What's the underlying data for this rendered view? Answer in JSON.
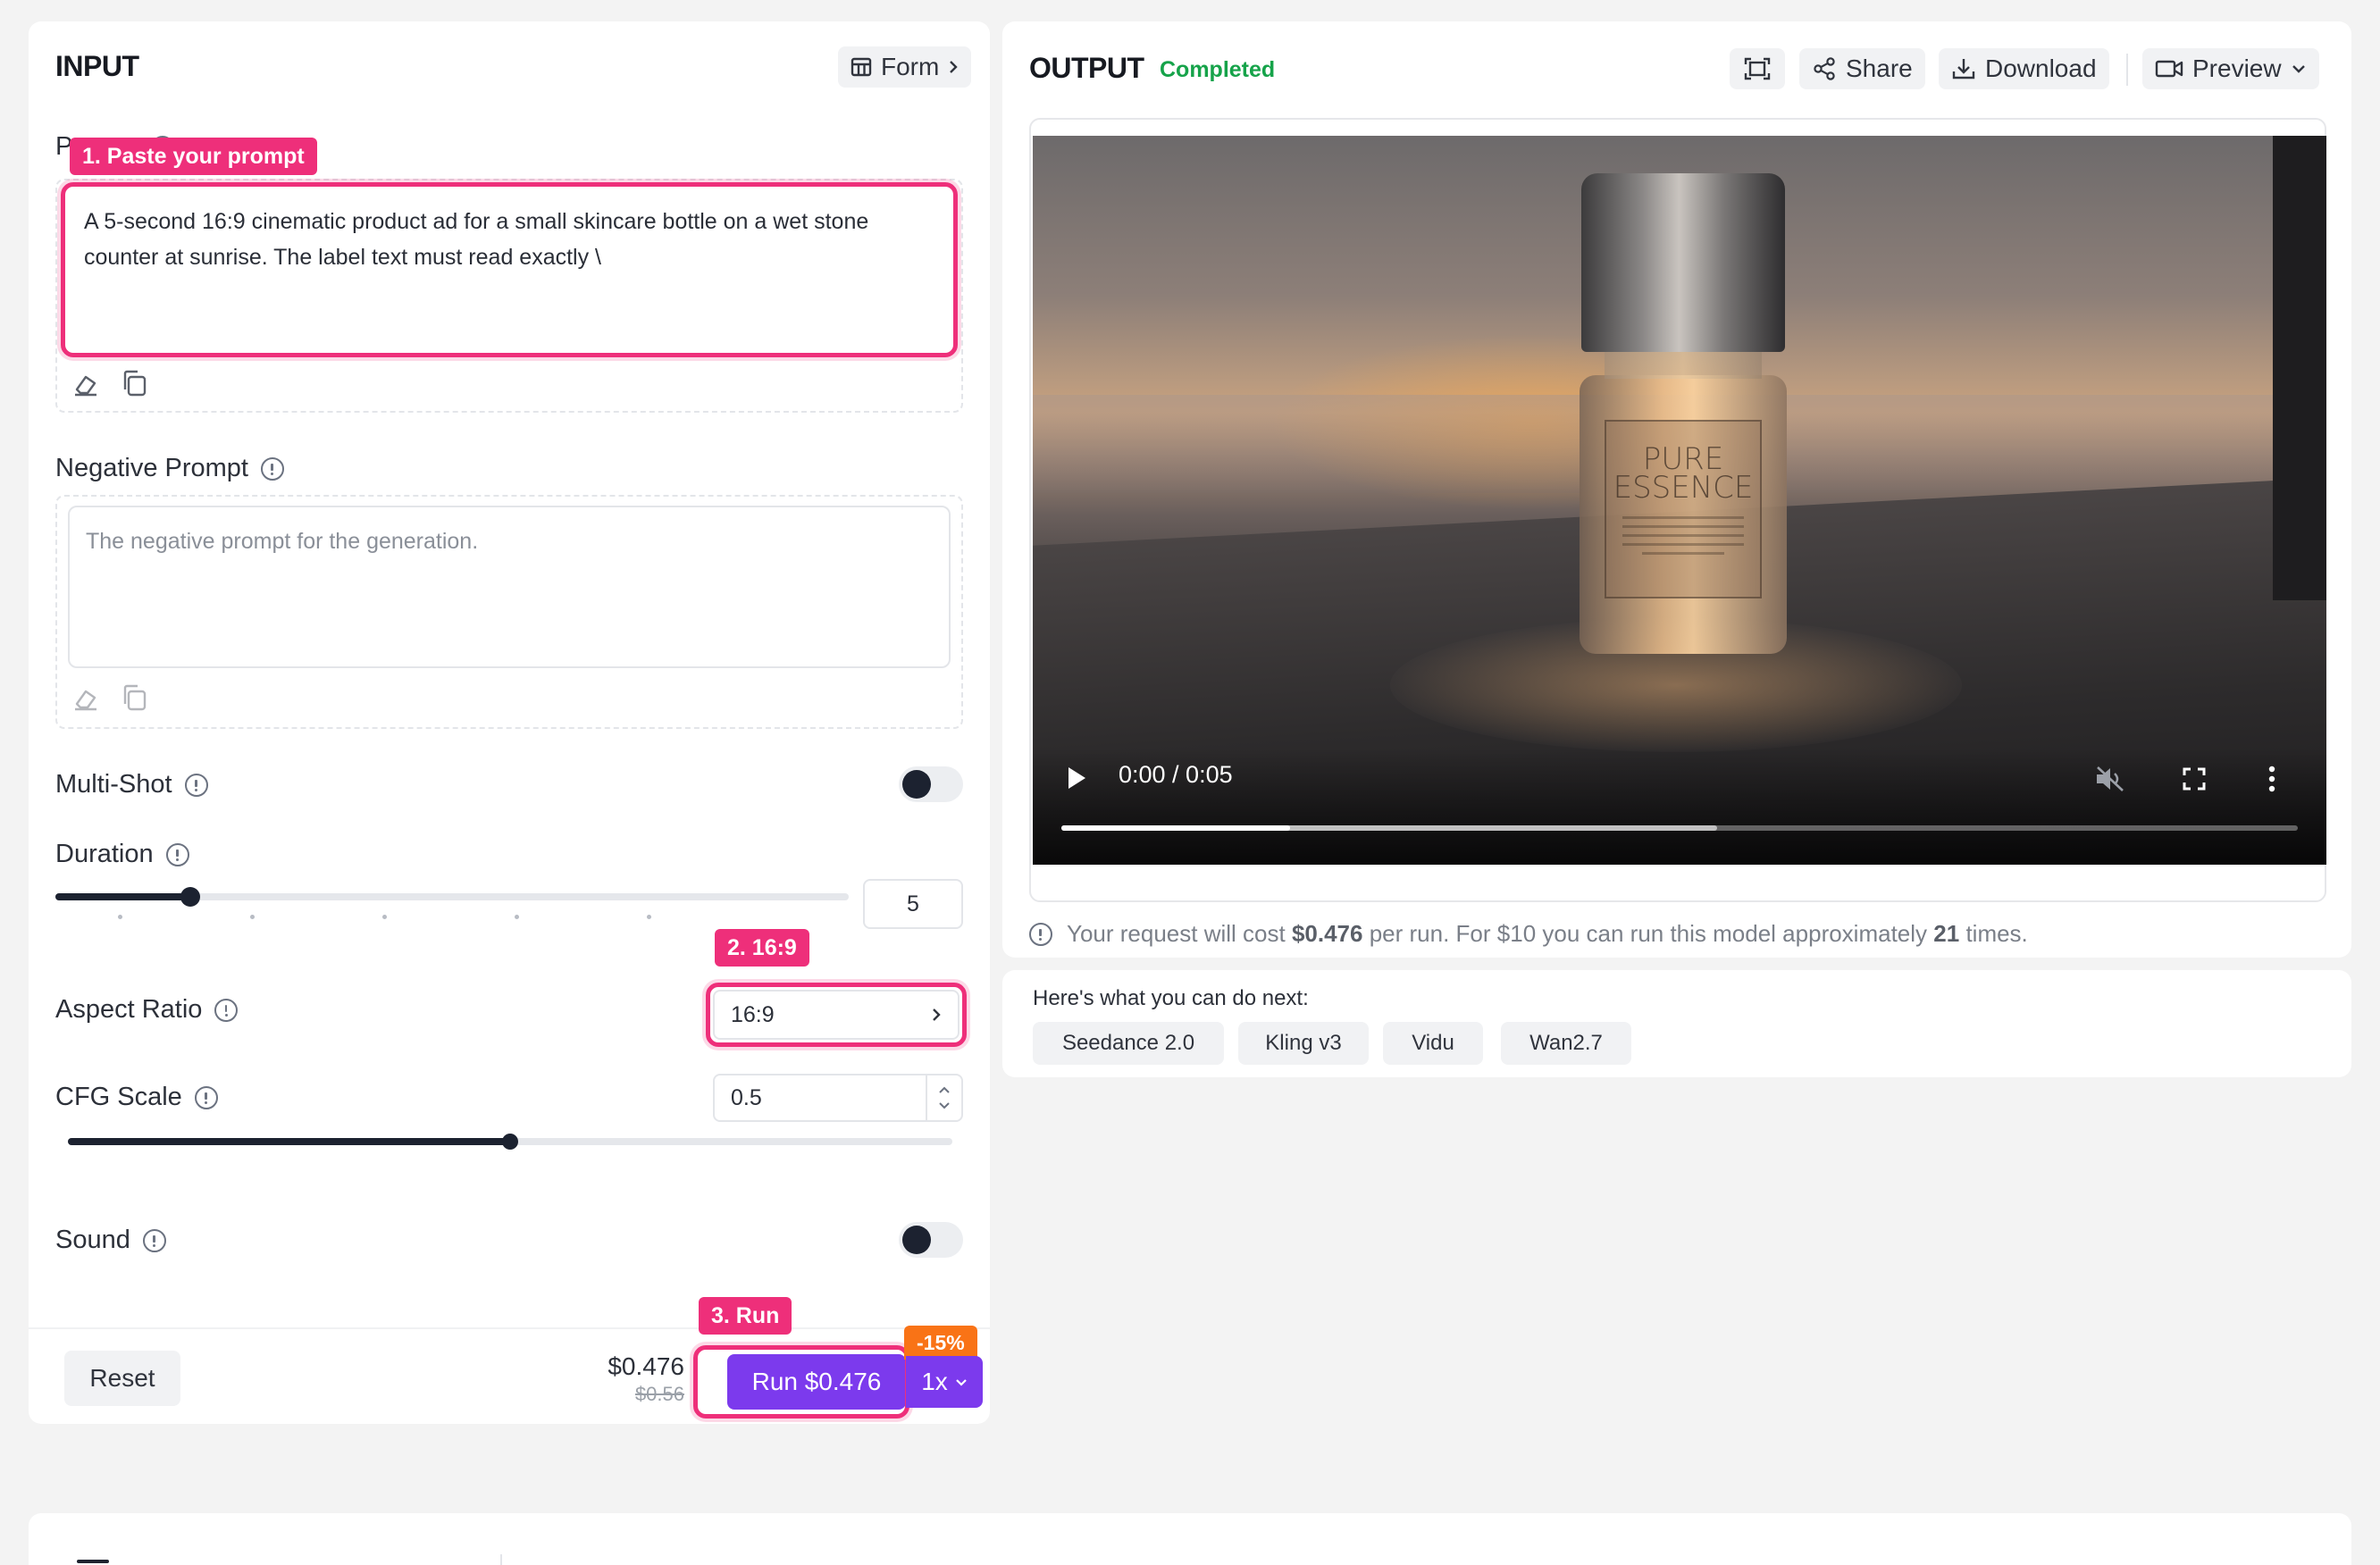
{
  "input": {
    "title": "INPUT",
    "form_button": "Form",
    "prompt": {
      "label": "Prompt",
      "value": "A 5-second 16:9 cinematic product ad for a small skincare bottle on a wet stone counter at sunrise. The label text must read exactly \\"
    },
    "negative_prompt": {
      "label": "Negative Prompt",
      "placeholder": "The negative prompt for the generation."
    },
    "multi_shot": {
      "label": "Multi-Shot",
      "enabled": false
    },
    "duration": {
      "label": "Duration",
      "value": "5",
      "slider_fraction": 0.17
    },
    "aspect_ratio": {
      "label": "Aspect Ratio",
      "value": "16:9"
    },
    "cfg_scale": {
      "label": "CFG Scale",
      "value": "0.5",
      "slider_fraction": 0.5
    },
    "sound": {
      "label": "Sound",
      "enabled": false
    }
  },
  "footer": {
    "reset_label": "Reset",
    "price": "$0.476",
    "old_price": "$0.56",
    "run_label": "Run $0.476",
    "multiplier": "1x",
    "discount": "-15%"
  },
  "annotations": {
    "step1": "1. Paste your prompt",
    "step2": "2. 16:9",
    "step3": "3. Run"
  },
  "output": {
    "title": "OUTPUT",
    "status": "Completed",
    "share_label": "Share",
    "download_label": "Download",
    "preview_label": "Preview",
    "video": {
      "time": "0:00 / 0:05",
      "progress_fraction": 0.0,
      "buffered_fraction": 0.53,
      "played_marker_fraction": 0.185,
      "label_line1": "PURE",
      "label_line2": "ESSENCE"
    },
    "cost_note": {
      "prefix": "Your request will cost",
      "cost": "$0.476",
      "middle": "per run. For $10 you can run this model approximately",
      "times": "21",
      "suffix": "times."
    }
  },
  "next": {
    "label": "Here's what you can do next:",
    "chips": [
      "Seedance 2.0",
      "Kling v3",
      "Vidu",
      "Wan2.7"
    ]
  },
  "colors": {
    "accent": "#7c3aed",
    "annotation": "#ee2f7a",
    "status": "#16a34a",
    "discount": "#f97316"
  }
}
